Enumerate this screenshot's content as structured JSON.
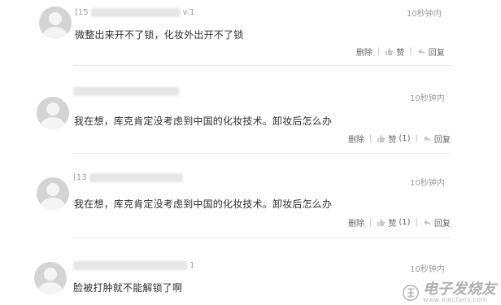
{
  "comments": [
    {
      "username_prefix": "[15",
      "username_suffix": "v.1",
      "time": "10秒钟内",
      "text": "微整出来开不了锁，化妆外出开不了锁",
      "actions": {
        "delete": "删除",
        "like": "赞",
        "like_count": "",
        "reply": "回复"
      }
    },
    {
      "username_prefix": "",
      "username_suffix": "",
      "time": "10秒钟内",
      "text": "我在想，库克肯定没考虑到中国的化妆技术。卸妆后怎么办",
      "actions": {
        "delete": "删除",
        "like": "赞",
        "like_count": "(1)",
        "reply": "回复"
      }
    },
    {
      "username_prefix": "[13",
      "username_suffix": "",
      "time": "10秒钟内",
      "text": "我在想，库克肯定没考虑到中国的化妆技术。卸妆后怎么办",
      "actions": {
        "delete": "删除",
        "like": "赞",
        "like_count": "(1)",
        "reply": "回复"
      }
    },
    {
      "username_prefix": "",
      "username_suffix": "1",
      "time": "10秒钟内",
      "text": "脸被打肿就不能解锁了啊",
      "actions": {
        "delete": "",
        "like": "",
        "like_count": "",
        "reply": ""
      }
    }
  ],
  "watermark": {
    "title": "电子发烧友",
    "url": "www.elecfans.com"
  },
  "icons": {
    "avatar": "default-avatar-icon",
    "like": "thumbs-up-icon",
    "reply": "reply-arrow-icon"
  }
}
